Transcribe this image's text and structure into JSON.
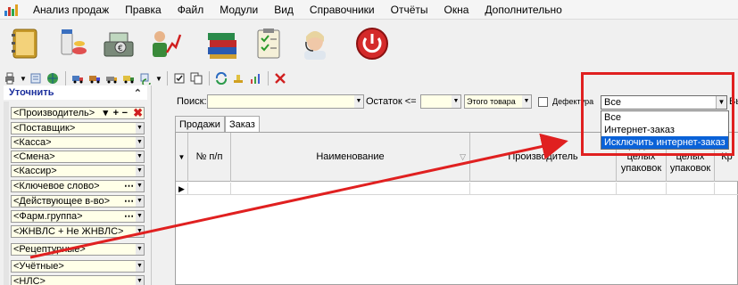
{
  "menu": {
    "items": [
      "Анализ продаж",
      "Правка",
      "Файл",
      "Модули",
      "Вид",
      "Справочники",
      "Отчёты",
      "Окна",
      "Дополнительно"
    ]
  },
  "toolbar": {
    "big_icons": [
      "address-book-icon",
      "medicine-icon",
      "cash-register-icon",
      "user-chart-icon",
      "books-icon",
      "checklist-icon",
      "operator-icon",
      "power-icon"
    ]
  },
  "left_panel": {
    "title": "Уточнить",
    "filters": [
      "<Производитель>",
      "<Поставщик>",
      "<Касса>",
      "<Смена>",
      "<Кассир>",
      "<Ключевое слово>",
      "<Действующее в-во>",
      "<Фарм.группа>",
      "<ЖНВЛС + Не ЖНВЛС>",
      "<Рецептурные>",
      "<Учётные>",
      "<НЛС>"
    ]
  },
  "search_bar": {
    "search_label": "Поиск:",
    "remainder_label": "Остаток <=",
    "product_label": "Этого товара",
    "defectura_label": "Дефектура",
    "defectura_checked": false,
    "trailing_text": "Вь"
  },
  "tabs": [
    "Продажи",
    "Заказ"
  ],
  "active_tab": "Заказ",
  "grid": {
    "columns": [
      "№ п/п",
      "Наименование",
      "Производитель",
      "Продано целых упаковок",
      "Остаток целых упаковок",
      "Кр"
    ]
  },
  "order_filter": {
    "selected": "Все",
    "options": [
      "Все",
      "Интернет-заказ",
      "Исключить интернет-заказ"
    ],
    "highlighted": "Исключить интернет-заказ"
  },
  "colors": {
    "accent": "#0a62d8",
    "annotation": "#e02020",
    "field_bg": "#ffffe8",
    "panel_title": "#1a2e9c"
  }
}
